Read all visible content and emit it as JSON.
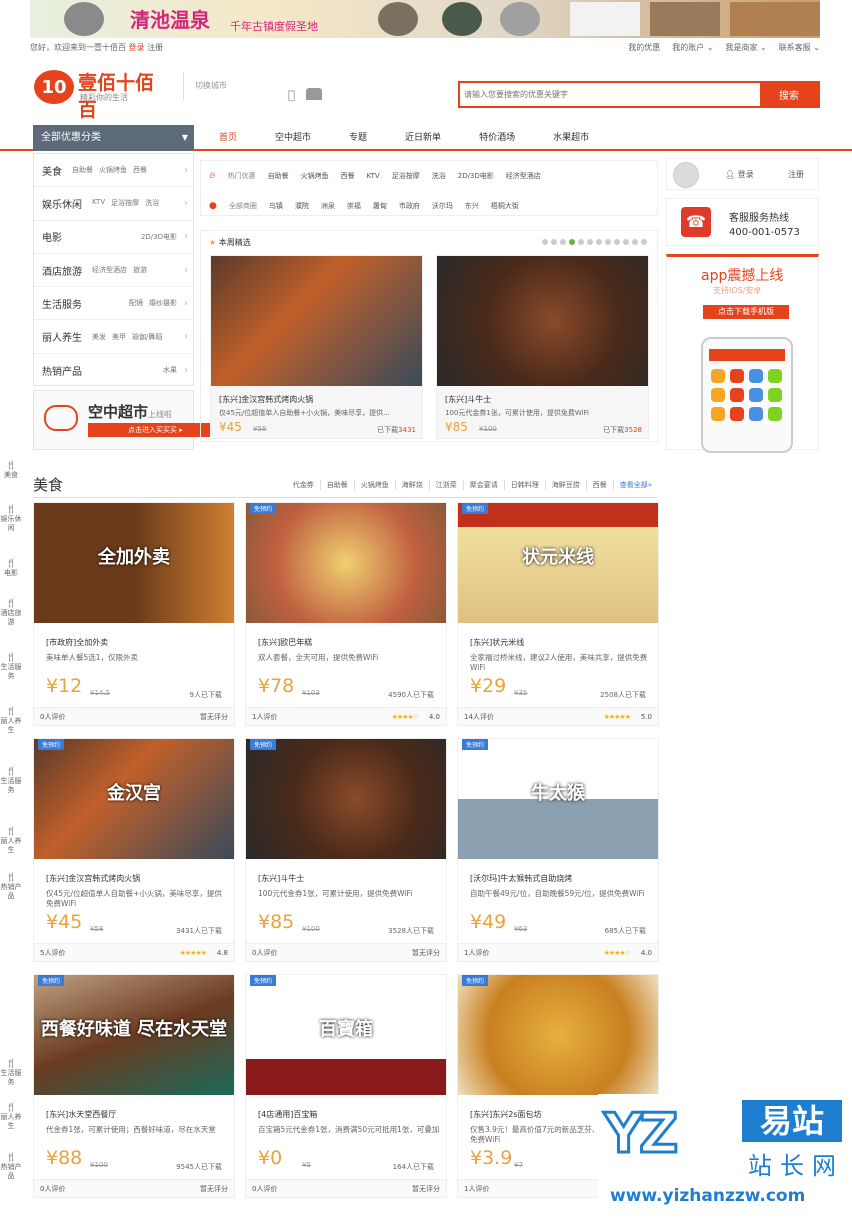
{
  "banner": {
    "title": "清池温泉",
    "subtitle": "千年古镇度假圣地"
  },
  "topbar": {
    "welcome": "您好，欢迎来到一壹十佰百",
    "login": "登录",
    "register": "注册",
    "links": [
      "我的优惠",
      "我的账户 ⌄",
      "我是商家 ⌄",
      "联系客服 ⌄"
    ]
  },
  "header": {
    "logo_mark": "10",
    "logo_text": "壹佰十佰百",
    "logo_sub": "精彩你的生活",
    "city": "切换城市",
    "search_placeholder": "请输入您要搜索的优惠关键字",
    "search_button": "搜索"
  },
  "nav": {
    "category_label": "全部优惠分类",
    "links": [
      "首页",
      "空中超市",
      "专题",
      "近日新单",
      "特价酒场",
      "水果超市"
    ]
  },
  "categories": [
    {
      "main": "美食",
      "subs": [
        "自助餐",
        "火锅烤鱼",
        "西餐"
      ]
    },
    {
      "main": "娱乐休闲",
      "subs": [
        "KTV",
        "足浴按摩",
        "洗浴"
      ]
    },
    {
      "main": "电影",
      "subs": [
        "2D/3D电影"
      ]
    },
    {
      "main": "酒店旅游",
      "subs": [
        "经济型酒店",
        "旅游"
      ]
    },
    {
      "main": "生活服务",
      "subs": [
        "配镜",
        "婚纱摄影"
      ]
    },
    {
      "main": "丽人养生",
      "subs": [
        "美发",
        "美甲",
        "瑜伽/舞蹈"
      ]
    },
    {
      "main": "热销产品",
      "subs": [
        "水果"
      ]
    }
  ],
  "supermarket": {
    "title": "空中超市",
    "tag": "上线啦",
    "button": "点击进入买买买 ▸"
  },
  "hot": {
    "label1": "热门优惠",
    "items1": [
      "自助餐",
      "火锅烤鱼",
      "西餐",
      "KTV",
      "足浴按摩",
      "洗浴",
      "2D/3D电影",
      "经济型酒店"
    ],
    "label2": "全部商圈",
    "items2": [
      "乌镇",
      "濮院",
      "洲泉",
      "崇福",
      "屠甸",
      "市政府",
      "沃尔玛",
      "东兴",
      "梧桐大街"
    ]
  },
  "weekly": {
    "title": "本周精选",
    "cards": [
      {
        "title": "[东兴]金汉宫韩式烤肉火锅",
        "desc": "仅45元/位超值单人自助餐+小火锅，美味尽享，提供...",
        "price": "¥45",
        "old": "¥58",
        "sold_prefix": "已下载",
        "sold": "3431"
      },
      {
        "title": "[东兴]斗牛士",
        "desc": "100元代金券1张，可累计使用，提供免费WiFi",
        "price": "¥85",
        "old": "¥100",
        "sold_prefix": "已下载",
        "sold": "3528"
      }
    ]
  },
  "account": {
    "login": "登录",
    "register": "注册"
  },
  "service": {
    "icon": "☎",
    "label": "客服服务热线",
    "phone": "400-001-0573"
  },
  "app": {
    "title": "app震撼上线",
    "sub": "支持IOS/安卓",
    "button": "点击下载手机版"
  },
  "sidenav": [
    "美食",
    "娱乐休闲",
    "电影",
    "酒店旅游",
    "生活服务",
    "丽人养生",
    "热销产品"
  ],
  "sidenav2": [
    "生活服务",
    "丽人养生",
    "热销产品"
  ],
  "food": {
    "title": "美食",
    "tags": [
      "代金券",
      "自助餐",
      "火锅烤鱼",
      "海鲜烧",
      "江浙菜",
      "聚会宴请",
      "日韩料理",
      "海鲜豆捞",
      "西餐"
    ],
    "more": "查看全部»",
    "cards": [
      {
        "badge": "",
        "img_text": "全加外卖",
        "title": "[市政府]全加外卖",
        "desc": "美味单人餐5选1，仅限外卖",
        "price": "¥12",
        "old": "¥14.5",
        "sold": "9人已下载",
        "reviews": "0人评价",
        "rating": "暂无评分",
        "stars": ""
      },
      {
        "badge": "免预约",
        "img_text": "",
        "title": "[东兴]欧巴年糕",
        "desc": "双人套餐，全天可用，提供免费WiFi",
        "price": "¥78",
        "old": "¥103",
        "sold": "4590人已下载",
        "reviews": "1人评价",
        "rating": "4.0",
        "stars": "★★★★☆"
      },
      {
        "badge": "免预约",
        "img_text": "状元米线",
        "title": "[东兴]状元米线",
        "desc": "全家福过桥米线，建议2人使用，美味共享，提供免费WiFi",
        "price": "¥29",
        "old": "¥35",
        "sold": "2508人已下载",
        "reviews": "14人评价",
        "rating": "5.0",
        "stars": "★★★★★"
      },
      {
        "badge": "免预约",
        "img_text": "金汉宫",
        "title": "[东兴]金汉宫韩式烤肉火锅",
        "desc": "仅45元/位超值单人自助餐+小火锅，美味尽享，提供免费WiFi",
        "price": "¥45",
        "old": "¥58",
        "sold": "3431人已下载",
        "reviews": "5人评价",
        "rating": "4.8",
        "stars": "★★★★★"
      },
      {
        "badge": "免预约",
        "img_text": "",
        "title": "[东兴]斗牛士",
        "desc": "100元代金券1张，可累计使用，提供免费WiFi",
        "price": "¥85",
        "old": "¥100",
        "sold": "3528人已下载",
        "reviews": "0人评价",
        "rating": "暂无评分",
        "stars": ""
      },
      {
        "badge": "免预约",
        "img_text": "牛太猴",
        "title": "[沃尔玛]牛太猴韩式自助烧烤",
        "desc": "自助午餐49元/位，自助晚餐59元/位，提供免费WiFi",
        "price": "¥49",
        "old": "¥63",
        "sold": "685人已下载",
        "reviews": "1人评价",
        "rating": "4.0",
        "stars": "★★★★☆"
      },
      {
        "badge": "免预约",
        "img_text": "西餐好味道 尽在水天堂",
        "title": "[东兴]水天堂西餐厅",
        "desc": "代金券1张，可累计使用；西餐好味道，尽在水天堂",
        "price": "¥88",
        "old": "¥100",
        "sold": "9545人已下载",
        "reviews": "0人评价",
        "rating": "暂无评分",
        "stars": ""
      },
      {
        "badge": "免预约",
        "img_text": "百寶箱",
        "title": "[4店通用]百宝箱",
        "desc": "百宝箱5元代金券1张，消费满50元可抵用1张，可叠加",
        "price": "¥0",
        "old": "¥5",
        "sold": "164人已下载",
        "reviews": "0人评价",
        "rating": "暂无评分",
        "stars": ""
      },
      {
        "badge": "免预约",
        "img_text": "",
        "title": "[东兴]东兴2s面包坊",
        "desc": "仅售3.9元！最高价值7元的新品芝芬、卡多蛋糕，提供免费WiFi",
        "price": "¥3.9",
        "old": "¥7",
        "sold": "",
        "reviews": "1人评价",
        "rating": "",
        "stars": "★★"
      }
    ]
  },
  "watermark": {
    "logo": "YZ",
    "cn1": "易站",
    "cn2": "站长网",
    "url": "www.yizhanzzw.com"
  }
}
